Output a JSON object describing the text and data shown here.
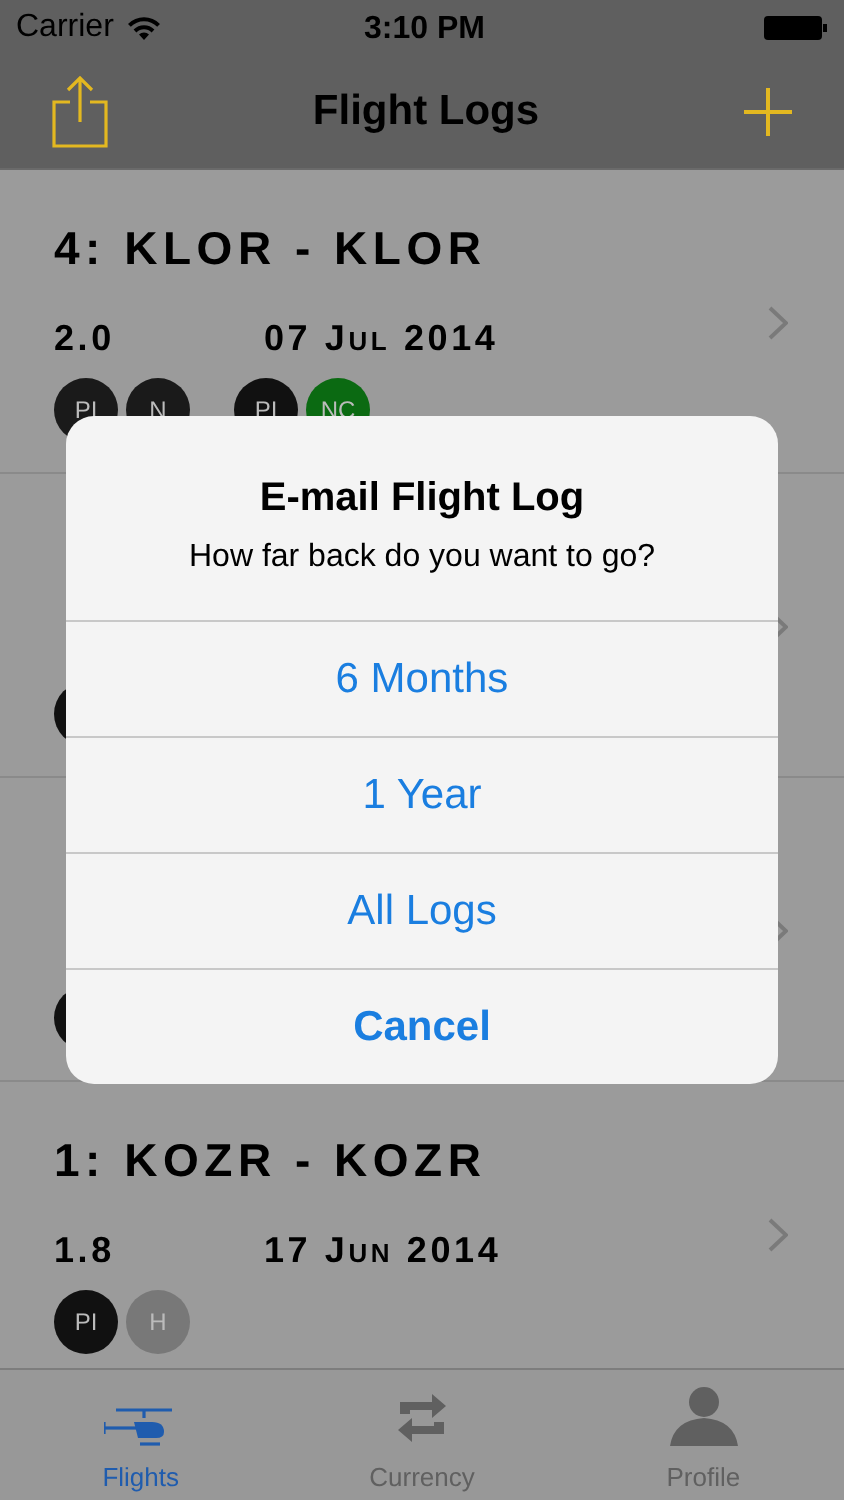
{
  "status_bar": {
    "carrier": "Carrier",
    "time": "3:10 PM"
  },
  "nav_bar": {
    "title": "Flight Logs"
  },
  "flights": [
    {
      "title": "4: KLOR - KLOR",
      "hours": "2.0",
      "date": "07 Jul 2014",
      "badges": [
        {
          "label": "PI",
          "color": "#1a1a1a"
        },
        {
          "label": "N",
          "color": "#1a1a1a"
        },
        {
          "label": "PI",
          "color": "#111111",
          "gap": true
        },
        {
          "label": "NC",
          "color": "#0b6a12"
        }
      ]
    },
    {
      "badges": [
        {
          "color": "#111111"
        }
      ]
    },
    {
      "badges": [
        {
          "color": "#111111"
        }
      ]
    },
    {
      "title": "1: KOZR - KOZR",
      "hours": "1.8",
      "date": "17 Jun 2014",
      "badges": [
        {
          "label": "PI",
          "color": "#111111"
        },
        {
          "label": "H",
          "color": "#787878"
        }
      ]
    }
  ],
  "alert": {
    "title": "E-mail Flight Log",
    "message": "How far back do you want to go?",
    "actions": [
      {
        "label": "6 Months",
        "kind": "default"
      },
      {
        "label": "1 Year",
        "kind": "default"
      },
      {
        "label": "All Logs",
        "kind": "default"
      },
      {
        "label": "Cancel",
        "kind": "cancel"
      }
    ]
  },
  "tabs": [
    {
      "label": "Flights",
      "selected": true,
      "kind": "helicopter"
    },
    {
      "label": "Currency",
      "selected": false,
      "kind": "repeat"
    },
    {
      "label": "Profile",
      "selected": false,
      "kind": "person"
    }
  ]
}
